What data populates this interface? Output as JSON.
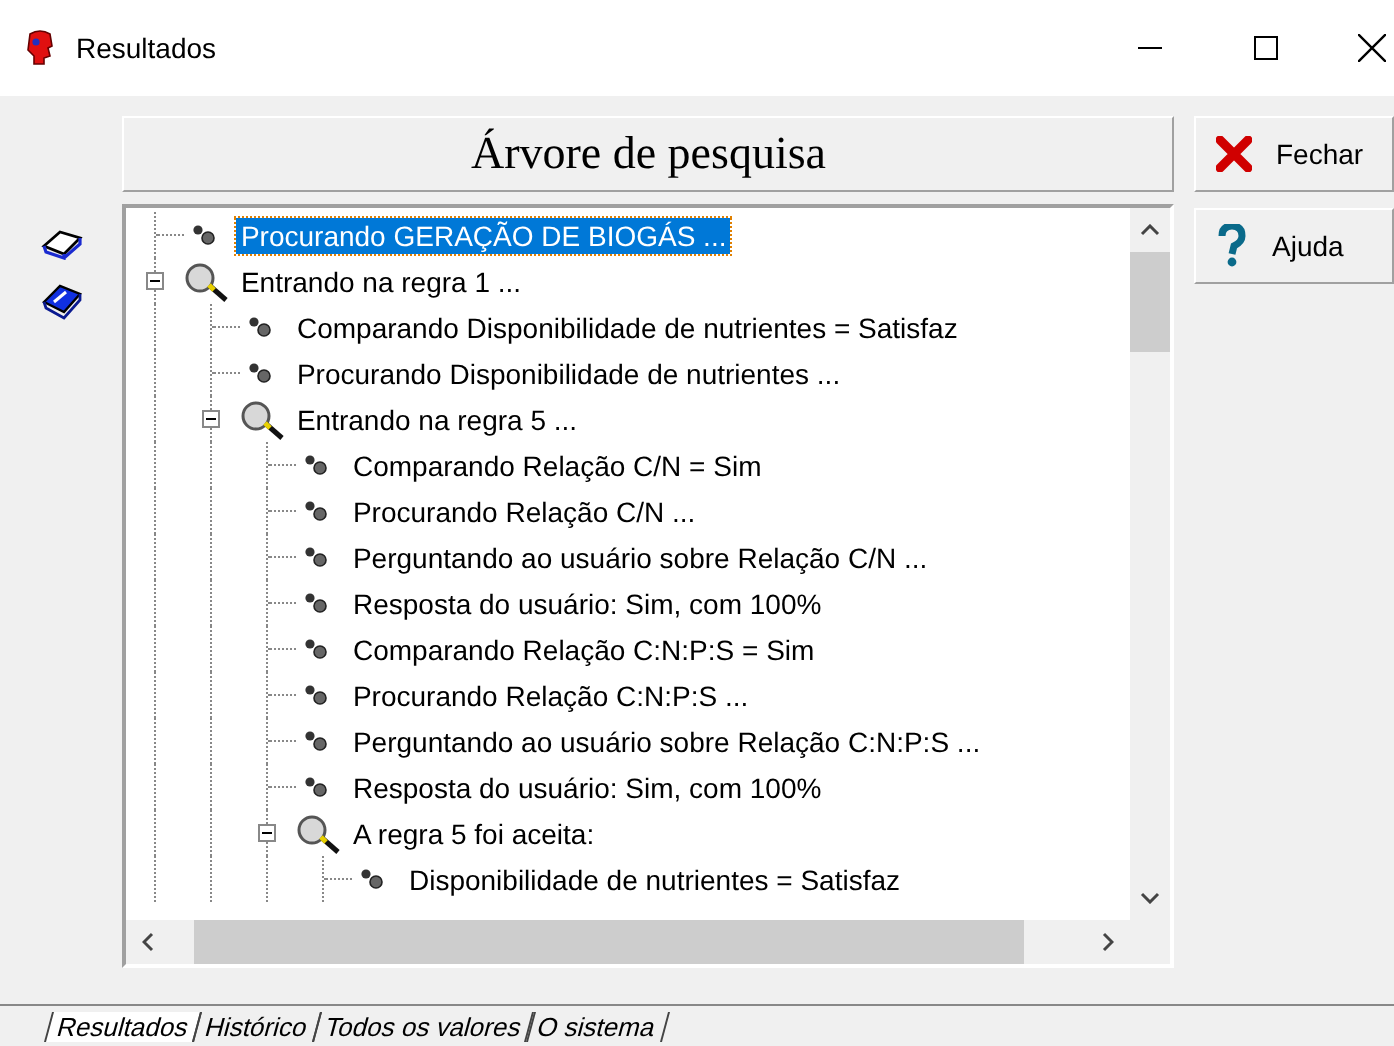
{
  "window": {
    "title": "Resultados"
  },
  "heading": "Árvore de pesquisa",
  "tree": [
    {
      "kind": "fact",
      "text": "Procurando GERAÇÃO DE BIOGÁS ...",
      "selected": true
    },
    {
      "kind": "rule",
      "text": "Entrando na regra 1 ...",
      "selected": false,
      "expanded": true,
      "children": [
        {
          "kind": "fact",
          "text": "Comparando Disponibilidade de nutrientes = Satisfaz",
          "selected": false
        },
        {
          "kind": "fact",
          "text": "Procurando Disponibilidade de nutrientes ...",
          "selected": false
        },
        {
          "kind": "rule",
          "text": "Entrando na regra 5 ...",
          "selected": false,
          "expanded": true,
          "children": [
            {
              "kind": "fact",
              "text": "Comparando Relação C/N = Sim",
              "selected": false
            },
            {
              "kind": "fact",
              "text": "Procurando Relação C/N ...",
              "selected": false
            },
            {
              "kind": "fact",
              "text": "Perguntando ao usuário sobre Relação C/N ...",
              "selected": false
            },
            {
              "kind": "fact",
              "text": "Resposta do usuário: Sim, com 100%",
              "selected": false
            },
            {
              "kind": "fact",
              "text": "Comparando Relação C:N:P:S = Sim",
              "selected": false
            },
            {
              "kind": "fact",
              "text": "Procurando Relação C:N:P:S ...",
              "selected": false
            },
            {
              "kind": "fact",
              "text": "Perguntando ao usuário sobre Relação C:N:P:S ...",
              "selected": false
            },
            {
              "kind": "fact",
              "text": "Resposta do usuário: Sim, com 100%",
              "selected": false
            },
            {
              "kind": "rule",
              "text": "A regra 5 foi aceita:",
              "selected": false,
              "expanded": true,
              "children": [
                {
                  "kind": "fact",
                  "text": "Disponibilidade de nutrientes = Satisfaz",
                  "selected": false
                }
              ]
            }
          ]
        }
      ]
    }
  ],
  "buttons": [
    {
      "kind": "close",
      "label": "Fechar"
    },
    {
      "kind": "help",
      "label": "Ajuda"
    }
  ],
  "tabs": [
    {
      "label": "Resultados",
      "selected": true
    },
    {
      "label": "Histórico",
      "selected": false
    },
    {
      "label": "Todos os valores",
      "selected": false
    },
    {
      "label": "O sistema",
      "selected": false
    }
  ]
}
